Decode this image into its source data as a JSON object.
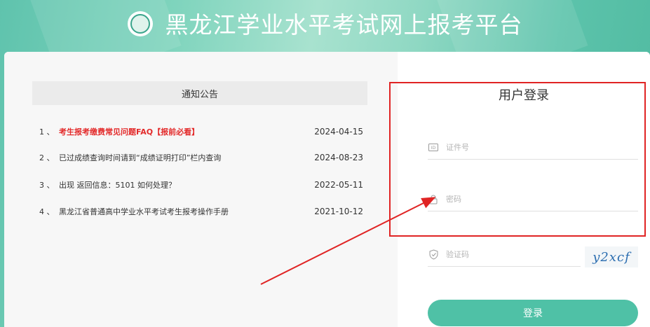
{
  "header": {
    "site_title": "黑龙江学业水平考试网上报考平台",
    "logo_icon": "emblem-icon"
  },
  "notice": {
    "heading": "通知公告",
    "items": [
      {
        "index": "1 、",
        "title": "考生报考缴费常见问题FAQ【报前必看】",
        "date": "2024-04-15",
        "highlight": true
      },
      {
        "index": "2 、",
        "title": "已过成绩查询时间请到“成绩证明打印”栏内查询",
        "date": "2024-08-23",
        "highlight": false
      },
      {
        "index": "3 、",
        "title": "出现 返回信息：5101 如何处理？",
        "date": "2022-05-11",
        "highlight": false
      },
      {
        "index": "4 、",
        "title": "黑龙江省普通高中学业水平考试考生报考操作手册",
        "date": "2021-10-12",
        "highlight": false
      }
    ]
  },
  "login": {
    "title": "用户登录",
    "id_placeholder": "证件号",
    "password_placeholder": "密码",
    "captcha_placeholder": "验证码",
    "captcha_text": "y2xcf",
    "submit_label": "登录"
  },
  "colors": {
    "accent": "#4fc1a6",
    "highlight_red": "#e32b2b",
    "annotation_red": "#e02424"
  }
}
